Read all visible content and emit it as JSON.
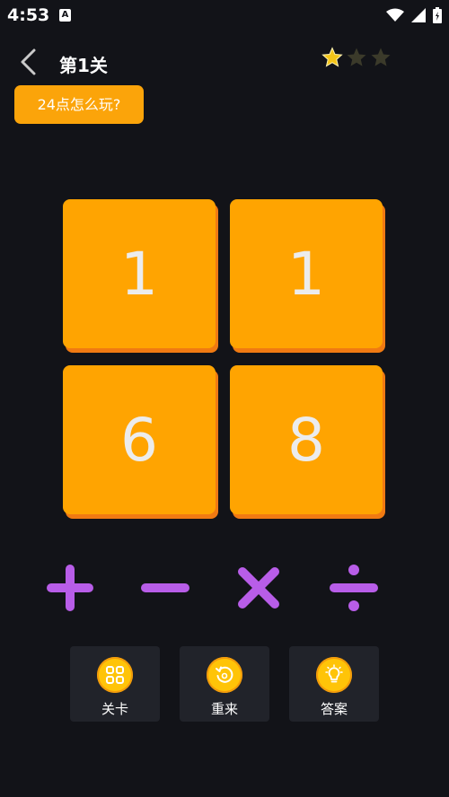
{
  "status": {
    "time": "4:53",
    "a_icon": "A"
  },
  "header": {
    "title": "第1关",
    "stars_earned": 1,
    "stars_total": 3
  },
  "help": {
    "label": "24点怎么玩?"
  },
  "cards": [
    "1",
    "1",
    "6",
    "8"
  ],
  "operators": [
    "plus-icon",
    "minus-icon",
    "times-icon",
    "divide-icon"
  ],
  "tools": [
    {
      "label": "关卡",
      "icon": "levels-icon"
    },
    {
      "label": "重来",
      "icon": "restart-icon"
    },
    {
      "label": "答案",
      "icon": "hint-bulb-icon"
    }
  ],
  "colors": {
    "background": "#121318",
    "card": "#ffa401",
    "card_shadow": "#f07a12",
    "operator": "#b85de8",
    "star_gold": "#f5c518",
    "star_empty": "#3b3a2a",
    "tool_bg": "#21232a",
    "tool_icon": "#ffc408"
  }
}
